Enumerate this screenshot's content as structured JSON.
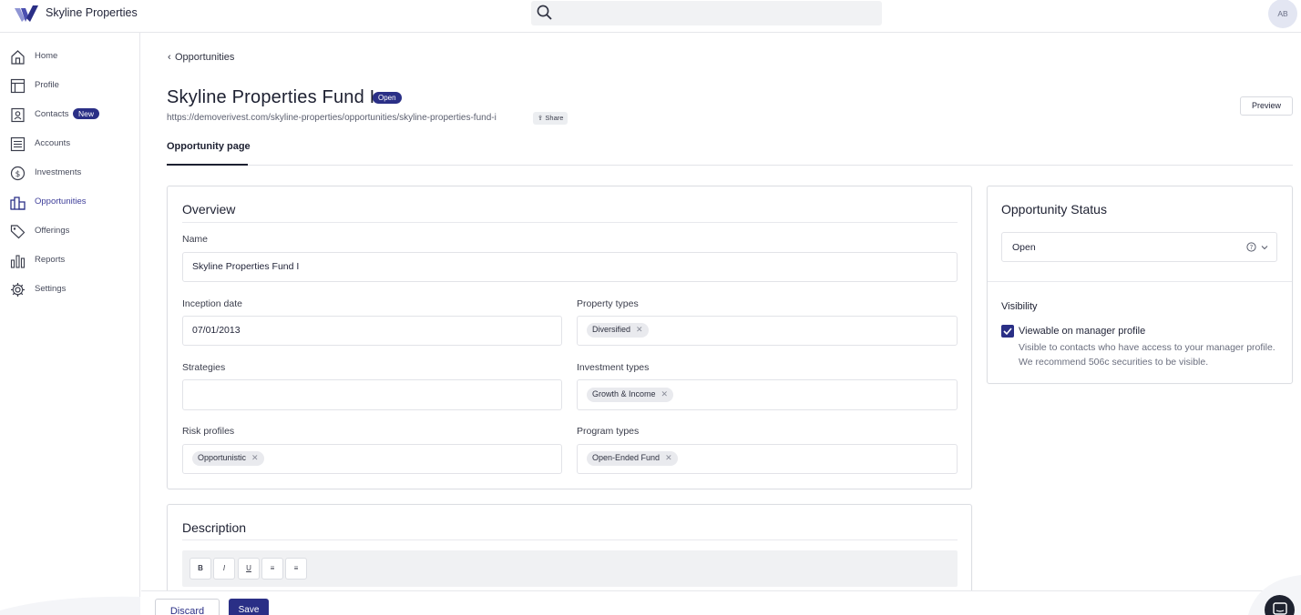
{
  "app": {
    "brand": "Skyline Properties",
    "avatar_initials": "AB",
    "accent_color": "#2a2f86"
  },
  "search": {
    "placeholder": ""
  },
  "sidebar": {
    "items": [
      {
        "label": "Home",
        "icon": "home-icon"
      },
      {
        "label": "Profile",
        "icon": "profile-icon"
      },
      {
        "label": "Contacts",
        "icon": "contacts-icon",
        "badge": "New"
      },
      {
        "label": "Accounts",
        "icon": "accounts-icon"
      },
      {
        "label": "Investments",
        "icon": "dollar-icon"
      },
      {
        "label": "Opportunities",
        "icon": "building-icon",
        "active": true
      },
      {
        "label": "Offerings",
        "icon": "tag-icon"
      },
      {
        "label": "Reports",
        "icon": "bar-chart-icon"
      },
      {
        "label": "Settings",
        "icon": "gear-icon"
      }
    ]
  },
  "breadcrumb": {
    "label": "Opportunities"
  },
  "header": {
    "title": "Skyline Properties Fund I",
    "status": "Open",
    "url": "https://demoverivest.com/skyline-properties/opportunities/skyline-properties-fund-i",
    "share_label": "Share",
    "preview_label": "Preview"
  },
  "tabs": [
    {
      "label": "Opportunity page",
      "active": true
    }
  ],
  "overview": {
    "title": "Overview",
    "name_label": "Name",
    "name_value": "Skyline Properties Fund I",
    "inception_label": "Inception date",
    "inception_value": "07/01/2013",
    "property_types_label": "Property types",
    "property_types": [
      "Diversified"
    ],
    "strategies_label": "Strategies",
    "strategies": [],
    "investment_types_label": "Investment types",
    "investment_types": [
      "Growth & Income"
    ],
    "risk_profiles_label": "Risk profiles",
    "risk_profiles": [
      "Opportunistic"
    ],
    "program_types_label": "Program types",
    "program_types": [
      "Open-Ended Fund"
    ]
  },
  "description": {
    "title": "Description",
    "toolbar": [
      "B",
      "I",
      "U",
      "≡",
      "≡"
    ]
  },
  "status_panel": {
    "title": "Opportunity Status",
    "selected": "Open",
    "visibility_label": "Visibility",
    "checkbox_label": "Viewable on manager profile",
    "checkbox_checked": true,
    "checkbox_help": "Visible to contacts who have access to your manager profile. We recommend 506c securities to be visible."
  },
  "footer": {
    "discard_label": "Discard",
    "save_label": "Save"
  }
}
